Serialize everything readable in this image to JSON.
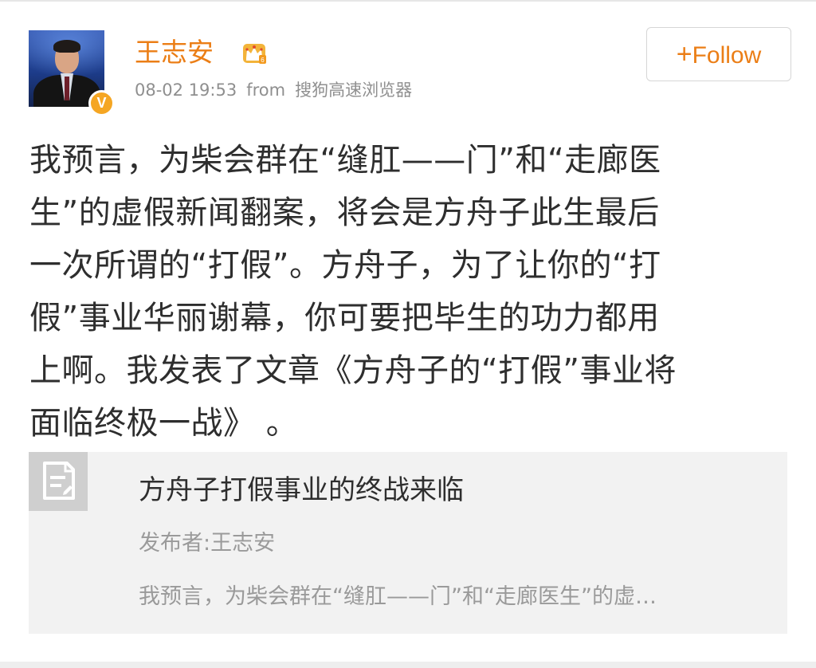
{
  "header": {
    "username": "王志安",
    "timestamp": "08-02 19:53",
    "from_label": "from",
    "source": "搜狗高速浏览器",
    "verified_mark": "V",
    "follow_plus": "+",
    "follow_label": "Follow",
    "icons": {
      "avatar": "user-avatar-photo",
      "verified": "verified-badge-icon",
      "member": "crown-member-icon"
    }
  },
  "post": {
    "lines": [
      "我预言，为柴会群在“缝肛——门”和“走廊医",
      "生”的虚假新闻翻案，将会是方舟子此生最后",
      "一次所谓的“打假”。方舟子，为了让你的“打",
      "假”事业华丽谢幕，你可要把毕生的功力都用",
      "上啊。我发表了文章《方舟子的“打假”事业将",
      "面临终极一战》 。"
    ]
  },
  "article_card": {
    "title": "方舟子打假事业的终战来临",
    "author": "发布者:王志安",
    "excerpt": "我预言，为柴会群在“缝肛——门”和“走廊医生”的虚…",
    "icon": "article-document-icon"
  },
  "colors": {
    "accent": "#eb7e16",
    "badge": "#f5a623",
    "text": "#2e2e2e",
    "muted": "#8f8f8f",
    "card_bg": "#f2f2f2"
  }
}
